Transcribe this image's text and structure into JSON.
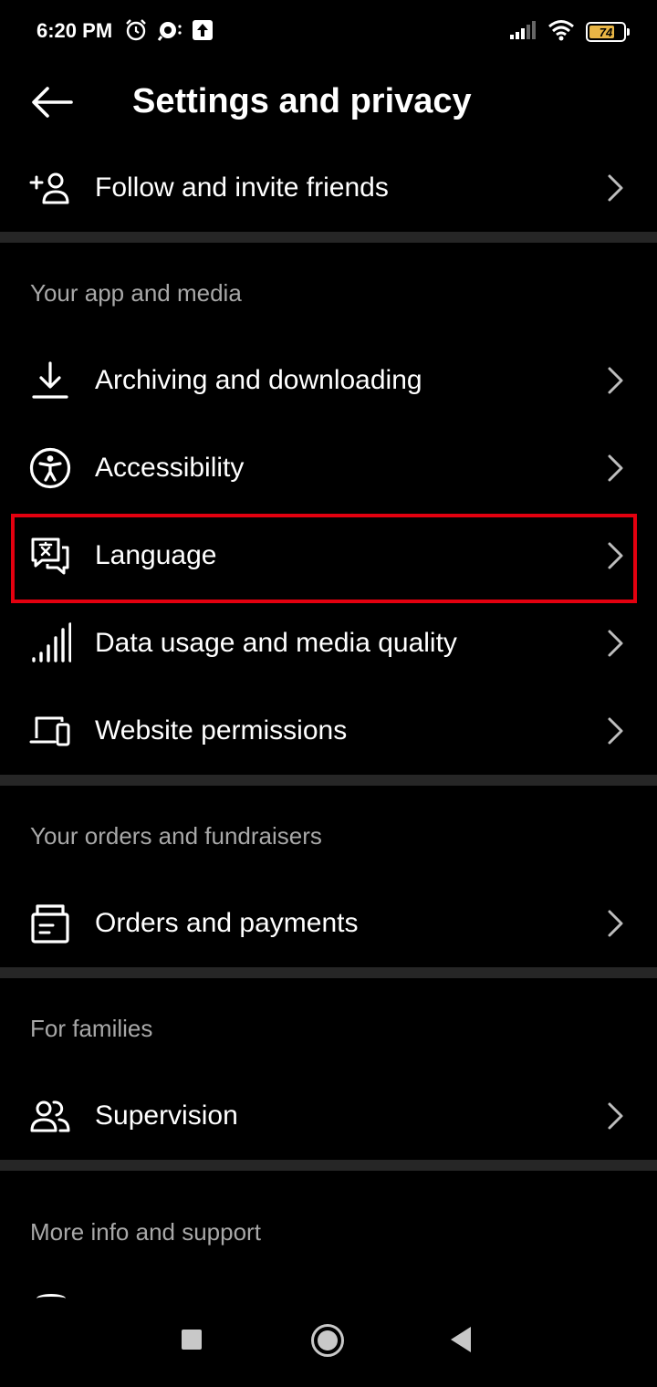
{
  "status_bar": {
    "time": "6:20 PM",
    "battery_level": "74",
    "battery_fraction": 0.74,
    "battery_color": "#e8b545",
    "left_icons": [
      "alarm-icon",
      "notification-icon",
      "upload-icon"
    ],
    "right_icons": [
      "signal-icon",
      "wifi-icon",
      "battery-icon"
    ]
  },
  "header": {
    "title": "Settings and privacy",
    "back_icon": "arrow-left-icon"
  },
  "items": {
    "follow_invite": {
      "label": "Follow and invite friends",
      "icon": "add-person-icon"
    },
    "archiving": {
      "label": "Archiving and downloading",
      "icon": "download-icon"
    },
    "accessibility": {
      "label": "Accessibility",
      "icon": "accessibility-icon"
    },
    "language": {
      "label": "Language",
      "icon": "language-icon"
    },
    "data_usage": {
      "label": "Data usage and media quality",
      "icon": "signal-bars-icon"
    },
    "website_permissions": {
      "label": "Website permissions",
      "icon": "devices-icon"
    },
    "orders_payments": {
      "label": "Orders and payments",
      "icon": "orders-icon"
    },
    "supervision": {
      "label": "Supervision",
      "icon": "people-icon"
    }
  },
  "sections": {
    "app_media": "Your app and media",
    "orders_fundraisers": "Your orders and fundraisers",
    "families": "For families",
    "more_info": "More info and support"
  },
  "colors": {
    "background": "#000000",
    "divider": "#262626",
    "section_text": "#a8a8a8",
    "highlight": "#e3000f"
  },
  "nav_bar": {
    "icons": [
      "recents-icon",
      "home-icon",
      "nav-back-icon"
    ]
  }
}
